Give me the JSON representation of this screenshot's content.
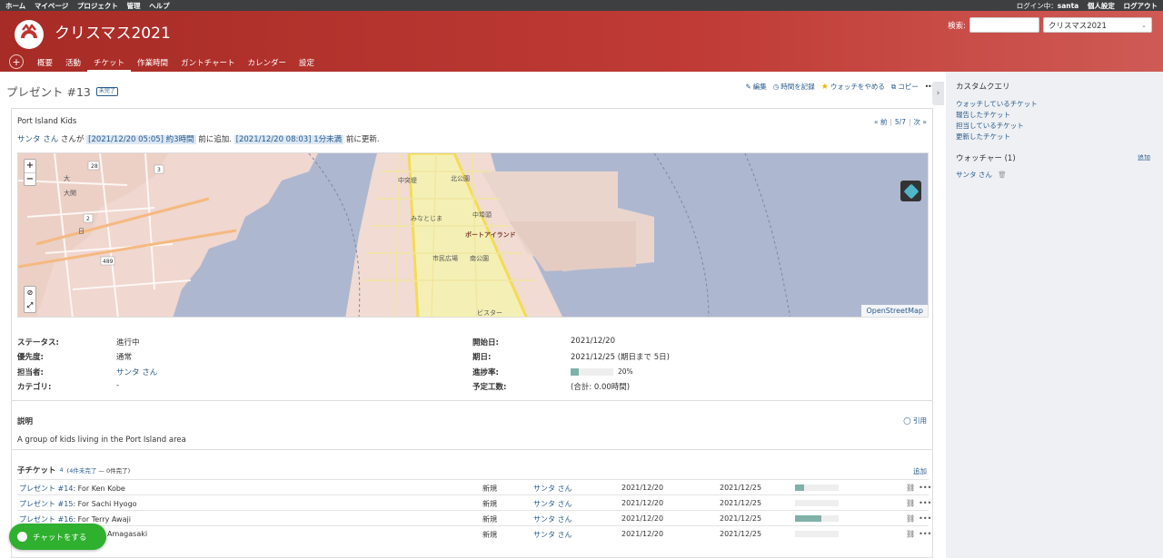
{
  "top_menu": {
    "items": [
      "ホーム",
      "マイページ",
      "プロジェクト",
      "管理",
      "ヘルプ"
    ],
    "logged_as_label": "ログイン中：",
    "username": "santa",
    "my_account": "個人設定",
    "logout": "ログアウト"
  },
  "header": {
    "project_title": "クリスマス2021",
    "search_label": "検索:",
    "search_placeholder": "",
    "project_select_value": "クリスマス2021"
  },
  "main_menu": {
    "new_label": "+",
    "tabs": [
      "概要",
      "活動",
      "チケット",
      "作業時間",
      "ガントチャート",
      "カレンダー",
      "設定"
    ],
    "selected": "チケット"
  },
  "issue": {
    "title": "プレゼント #13",
    "badge": "未完了",
    "actions": {
      "edit": "編集",
      "log_time": "時間を記録",
      "unwatch": "ウォッチをやめる",
      "copy": "コピー",
      "more": "•••"
    },
    "subject": "Port Island Kids",
    "prev_next": {
      "prev": "« 前",
      "position": "5/7",
      "next": "次 »"
    },
    "author": {
      "user": "サンタ さん",
      "text_ga": "さんが",
      "created_link": "[2021/12/20 05:05] 約3時間",
      "created_suffix": "前に追加.",
      "updated_link": "[2021/12/20 08:03] 1分未満",
      "updated_suffix": "前に更新."
    },
    "map": {
      "zoom_in": "+",
      "zoom_out": "−",
      "attribution": "OpenStreetMap",
      "labels": [
        "中突堤",
        "みなとじま",
        "中埠頭",
        "ポートアイランド",
        "市民広場",
        "南公園",
        "北公園",
        "ビスター",
        "28",
        "3",
        "2",
        "489",
        "大関",
        "日",
        "大"
      ]
    },
    "attributes": {
      "status_label": "ステータス:",
      "status": "進行中",
      "priority_label": "優先度:",
      "priority": "通常",
      "assignee_label": "担当者:",
      "assignee": "サンタ さん",
      "category_label": "カテゴリ:",
      "category": "-",
      "start_label": "開始日:",
      "start": "2021/12/20",
      "due_label": "期日:",
      "due": "2021/12/25 (期日まで 5日)",
      "done_label": "進捗率:",
      "done": "20%",
      "done_ratio": 0.2,
      "estimated_label": "予定工数:",
      "estimated": "(合計: 0.00時間)"
    },
    "description": {
      "title": "説明",
      "quote": "引用",
      "text": "A group of kids living in the Port Island area"
    },
    "subtasks": {
      "title": "子チケット",
      "count": "4",
      "summary": "(4件未完了 — 0件完了)",
      "summary_open": "4件未完了",
      "summary_rest": " — 0件完了)",
      "add": "追加",
      "rows": [
        {
          "link": "プレゼント #14",
          "subject": ": For Ken Kobe",
          "status": "新規",
          "assignee": "サンタ さん",
          "start": "2021/12/20",
          "due": "2021/12/25",
          "progress": 0.2
        },
        {
          "link": "プレゼント #15",
          "subject": ": For Sachi Hyogo",
          "status": "新規",
          "assignee": "サンタ さん",
          "start": "2021/12/20",
          "due": "2021/12/25",
          "progress": 0
        },
        {
          "link": "プレゼント #16",
          "subject": ": For Terry Awaji",
          "status": "新規",
          "assignee": "サンタ さん",
          "start": "2021/12/20",
          "due": "2021/12/25",
          "progress": 0.6
        },
        {
          "link": "",
          "subject": "Amagasaki",
          "status": "新規",
          "assignee": "サンタ さん",
          "start": "2021/12/20",
          "due": "2021/12/25",
          "progress": 0
        }
      ]
    }
  },
  "sidebar": {
    "custom_queries_title": "カスタムクエリ",
    "queries": [
      "ウォッチしているチケット",
      "報告したチケット",
      "担当しているチケット",
      "更新したチケット"
    ],
    "watchers_title": "ウォッチャー (1)",
    "watchers_add": "追加",
    "watcher": "サンタ さん"
  },
  "chat": {
    "label": "チャットをする"
  },
  "colors": {
    "header": "#a72b26",
    "progress": "#7fb1a9",
    "link": "#2a5a8a",
    "chat": "#2fb02f"
  }
}
